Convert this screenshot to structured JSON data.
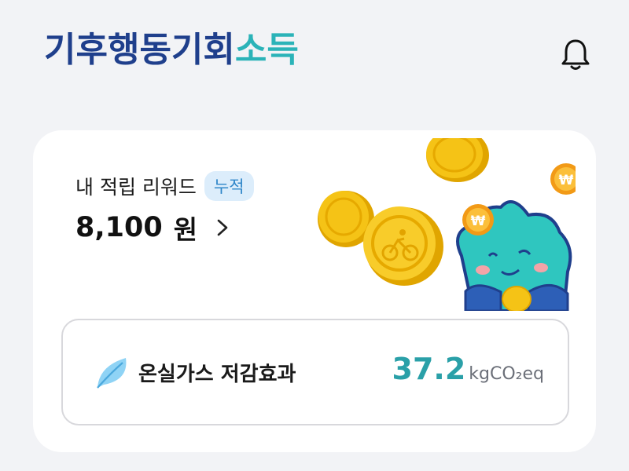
{
  "header": {
    "logo_text_1": "기후행동기회",
    "logo_text_2": "소득",
    "notification_icon": "bell-icon"
  },
  "reward": {
    "title": "내 적립 리워드",
    "badge": "누적",
    "amount": "8,100",
    "unit": "원",
    "chevron_icon": "chevron-right-icon"
  },
  "effect": {
    "icon": "leaf-icon",
    "label": "온실가스 저감효과",
    "value": "37.2",
    "unit": "kgCO₂eq"
  },
  "colors": {
    "logo": "#1f3f8c",
    "logo_accent": "#2bb3b8",
    "badge_bg": "#dcedfb",
    "badge_text": "#2f86c9",
    "effect_value": "#2aa0a8",
    "coin": "#f5c316",
    "mascot": "#2fc6bf"
  }
}
